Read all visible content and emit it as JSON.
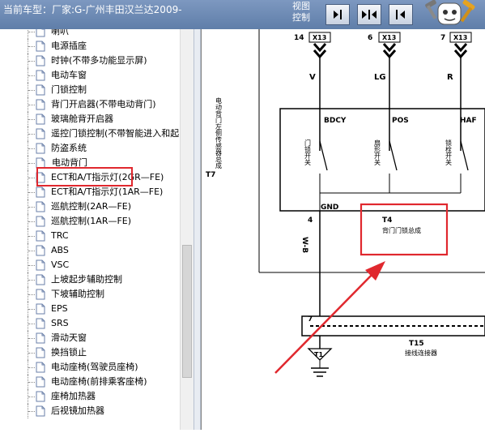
{
  "header": {
    "title": "当前车型：厂家:G-广州丰田汉兰达2009-",
    "view_label": "视图控制",
    "buttons": [
      {
        "name": "expand-right",
        "icon": "arrow-right-bar-icon"
      },
      {
        "name": "expand-both",
        "icon": "arrows-inward-icon"
      },
      {
        "name": "collapse-left",
        "icon": "arrow-left-bar-icon"
      }
    ],
    "mascot_icon": "repair-tools-mascot-icon"
  },
  "tree": {
    "items": [
      "喇叭",
      "电源插座",
      "时钟(不带多功能显示屏)",
      "电动车窗",
      "门锁控制",
      "背门开启器(不带电动背门)",
      "玻璃舱背开启器",
      "遥控门锁控制(不带智能进入和起",
      "防盗系统",
      "电动背门",
      "ECT和A/T指示灯(2GR—FE)",
      "ECT和A/T指示灯(1AR—FE)",
      "巡航控制(2AR—FE)",
      "巡航控制(1AR—FE)",
      "TRC",
      "ABS",
      "VSC",
      "上坡起步辅助控制",
      "下坡辅助控制",
      "EPS",
      "SRS",
      "滑动天窗",
      "换挡锁止",
      "电动座椅(驾驶员座椅)",
      "电动座椅(前排乘客座椅)",
      "座椅加热器",
      "后视镜加热器"
    ],
    "selected_index": 9,
    "selected_label": "电动背门"
  },
  "diagram": {
    "connector_top": [
      {
        "pin": "14",
        "conn": "X13",
        "wire": "V"
      },
      {
        "pin": "6",
        "conn": "X13",
        "wire": "LG"
      },
      {
        "pin": "7",
        "conn": "X13",
        "wire": "R"
      }
    ],
    "side_label_code": "T7",
    "side_label_text": "电动背门左侧传感器总成",
    "terminals": [
      "BDCY",
      "POS",
      "HAF"
    ],
    "switches": [
      "门锁开关",
      "扇形开关",
      "锁栓开关"
    ],
    "gnd_label": "GND",
    "pin_gnd": "4",
    "wire_gnd": "W-B",
    "callout_code": "T4",
    "callout_text": "背门门锁总成",
    "connector_pin": "7",
    "connector_code": "T15",
    "connector_text": "接线连接器",
    "ground_code": "T1",
    "colors": {
      "annotation": "#e0282e",
      "header": "#6f8bb5"
    }
  }
}
